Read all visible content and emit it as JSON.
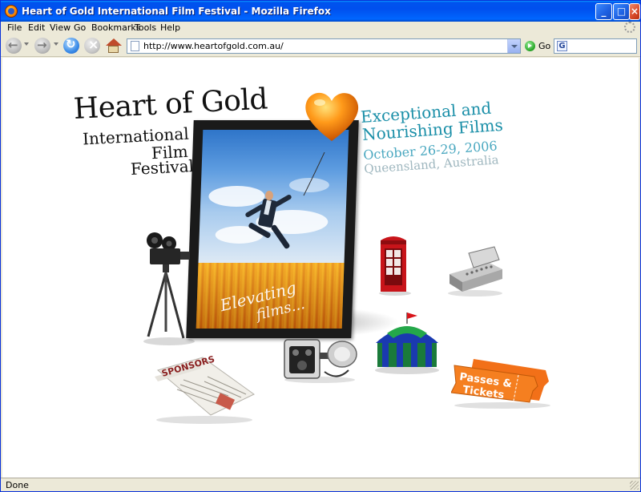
{
  "window": {
    "title": "Heart of Gold International Film Festival - Mozilla Firefox"
  },
  "menu": {
    "items": [
      "File",
      "Edit",
      "View",
      "Go",
      "Bookmarks",
      "Tools",
      "Help"
    ]
  },
  "toolbar": {
    "url": "http://www.heartofgold.com.au/",
    "go_label": "Go",
    "search_value": ""
  },
  "page": {
    "logo": {
      "line1": "Heart of Gold",
      "line2": "International",
      "line3": "Film",
      "line4": "Festival"
    },
    "tagline": {
      "line1": "Exceptional and",
      "line2": "Nourishing Films",
      "dates": "October 26-29, 2006",
      "location": "Queensland, Australia"
    },
    "poster": {
      "slogan_line1": "Elevating",
      "slogan_line2": "films..."
    },
    "props": {
      "newspaper_label": "SPONSORS",
      "tickets_label_line1": "Passes &",
      "tickets_label_line2": "Tickets"
    }
  },
  "status": {
    "text": "Done"
  },
  "colors": {
    "title_bar": "#0053ee",
    "tagline_teal": "#1a8fa8",
    "tagline_gray": "#9fb7bf",
    "balloon_orange": "#ff8a00",
    "tickets_orange": "#f57f20"
  },
  "icons": [
    "firefox-icon",
    "back-icon",
    "forward-icon",
    "reload-icon",
    "stop-icon",
    "home-icon",
    "page-icon",
    "go-icon",
    "google-icon",
    "throbber-icon"
  ]
}
